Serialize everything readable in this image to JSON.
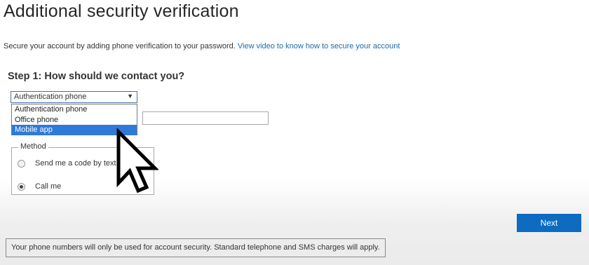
{
  "header": {
    "title": "Additional security verification"
  },
  "intro": {
    "text": "Secure your account by adding phone verification to your password.",
    "link": "View video to know how to secure your account"
  },
  "step1": {
    "title": "Step 1: How should we contact you?",
    "select_value": "Authentication phone",
    "options": [
      "Authentication phone",
      "Office phone",
      "Mobile app"
    ],
    "highlighted_option": "Mobile app",
    "phone_value": ""
  },
  "method": {
    "legend": "Method",
    "options": [
      {
        "label": "Send me a code by text",
        "checked": false
      },
      {
        "label": "Call me",
        "checked": true
      }
    ]
  },
  "actions": {
    "next_label": "Next"
  },
  "footer": {
    "notice": "Your phone numbers will only be used for account security. Standard telephone and SMS charges will apply."
  },
  "icons": {
    "dropdown_arrow": "triangle-down-icon",
    "pointer": "mouse-pointer-icon"
  },
  "colors": {
    "link": "#1e6aa8",
    "primary_button": "#0d6bc1",
    "highlight": "#2f7ad8"
  }
}
